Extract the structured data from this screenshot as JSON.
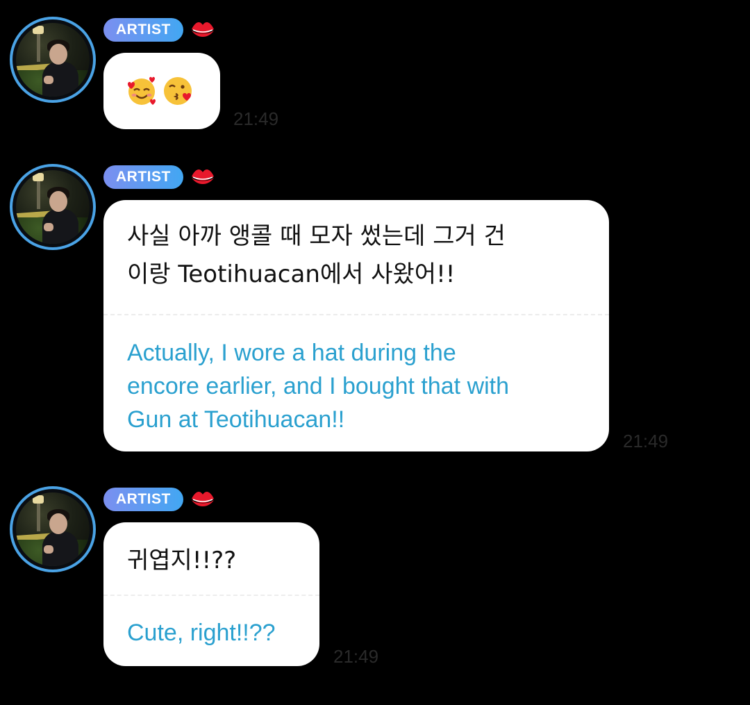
{
  "messages": [
    {
      "sender_badge": "ARTIST",
      "reaction_icon": "lips-icon",
      "emoji": [
        "smiling-face-with-hearts-icon",
        "face-blowing-kiss-icon"
      ],
      "time": "21:49"
    },
    {
      "sender_badge": "ARTIST",
      "reaction_icon": "lips-icon",
      "korean_lines": [
        "사실 아까 앵콜 때 모자 썼는데 그거 건",
        "이랑 Teotihuacan에서 사왔어!!"
      ],
      "english_lines": [
        "Actually, I wore a hat during the",
        "encore earlier, and I bought that with",
        "Gun at Teotihuacan!!"
      ],
      "time": "21:49"
    },
    {
      "sender_badge": "ARTIST",
      "reaction_icon": "lips-icon",
      "korean_lines": [
        "귀엽지!!??"
      ],
      "english_lines": [
        "Cute, right!!??"
      ],
      "time": "21:49"
    }
  ],
  "colors": {
    "background": "#000000",
    "bubble": "#ffffff",
    "translation_text": "#2aa0cf",
    "badge_gradient_start": "#7b8ff0",
    "badge_gradient_end": "#42a7f2",
    "avatar_ring": "#4aa3e6",
    "reaction": "#e8192c"
  }
}
